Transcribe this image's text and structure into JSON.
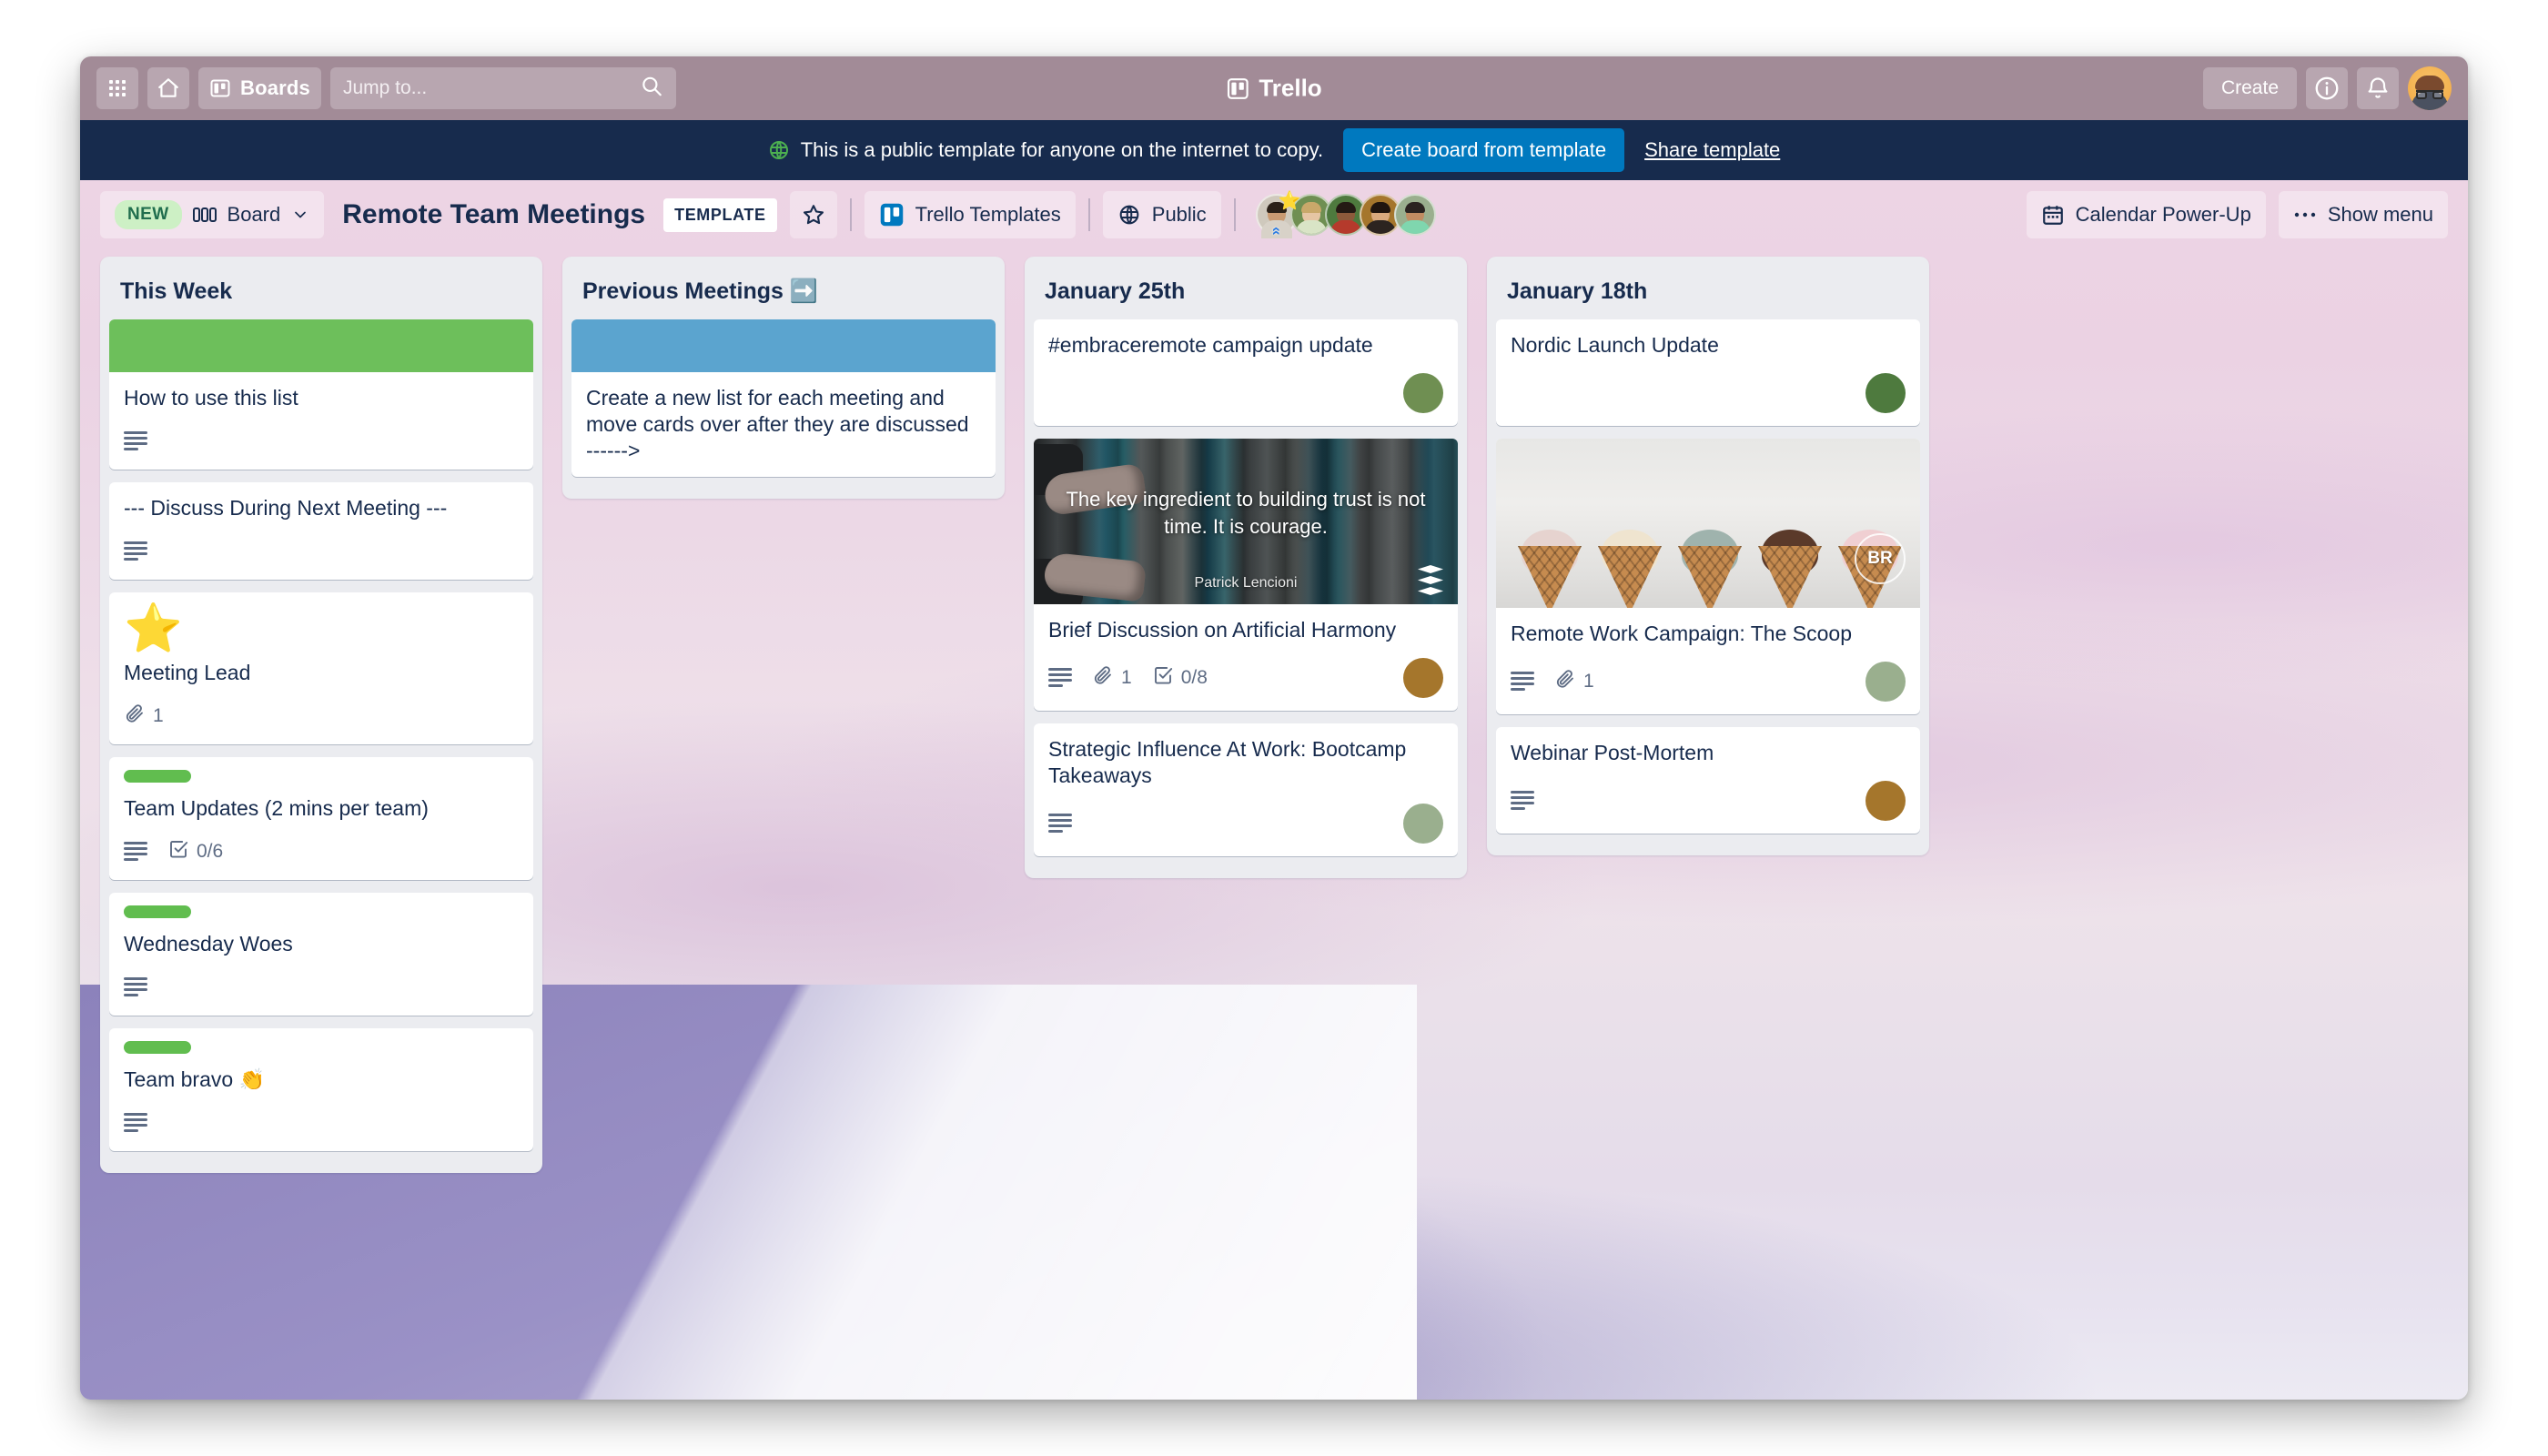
{
  "topnav": {
    "apps_icon": "apps-grid-icon",
    "home_icon": "home-icon",
    "boards_label": "Boards",
    "boards_icon": "board-icon",
    "search_placeholder": "Jump to...",
    "search_icon": "search-icon",
    "brand": "Trello",
    "brand_icon": "trello-logo-icon",
    "create_label": "Create",
    "info_icon": "info-circle-icon",
    "notifications_icon": "bell-icon",
    "avatar": "user-avatar"
  },
  "banner": {
    "globe_icon": "globe-icon",
    "text": "This is a public template for anyone on the internet to copy.",
    "cta_label": "Create board from template",
    "link_label": "Share template",
    "bg_color": "#172b4d",
    "cta_color": "#0079bf"
  },
  "board_header": {
    "new_badge": "NEW",
    "view_label": "Board",
    "view_icon": "board-view-icon",
    "chevron_icon": "chevron-down-icon",
    "title": "Remote Team Meetings",
    "template_chip": "TEMPLATE",
    "star_icon": "star-outline-icon",
    "workspace_label": "Trello Templates",
    "workspace_icon": "trello-logo-icon",
    "visibility_label": "Public",
    "visibility_icon": "globe-icon",
    "members": [
      {
        "name": "member-1",
        "skin": "#c99a72",
        "hair": "#2b2118",
        "shirt": "#d8d2c8",
        "bg": "#cfc9bd",
        "badge": "star"
      },
      {
        "name": "member-2",
        "skin": "#e6c5a4",
        "hair": "#c9a86a",
        "shirt": "#d9e4c6",
        "bg": "#6f8f52"
      },
      {
        "name": "member-3",
        "skin": "#8d5a3b",
        "hair": "#241a14",
        "shirt": "#b53a2c",
        "bg": "#4e7a3e"
      },
      {
        "name": "member-4",
        "skin": "#d9a97e",
        "hair": "#20150f",
        "shirt": "#2c2420",
        "bg": "#a5762c"
      },
      {
        "name": "member-5",
        "skin": "#c08c62",
        "hair": "#2a2320",
        "shirt": "#7fd6ae",
        "bg": "#9aaf8e"
      }
    ],
    "calendar_label": "Calendar Power-Up",
    "calendar_icon": "calendar-icon",
    "menu_label": "Show menu",
    "menu_icon": "ellipsis-icon"
  },
  "lists": [
    {
      "title": "This Week",
      "cards": [
        {
          "kind": "cover-band",
          "cover_color": "#6dbf5b",
          "title": "How to use this list",
          "badges": {
            "description": true
          }
        },
        {
          "kind": "plain",
          "title": "--- Discuss During Next Meeting ---",
          "badges": {
            "description": true
          }
        },
        {
          "kind": "emoji",
          "emoji": "⭐",
          "title": "Meeting Lead",
          "badges": {
            "attachments": "1"
          }
        },
        {
          "kind": "label",
          "label_color": "#61bd4f",
          "title": "Team Updates (2 mins per team)",
          "badges": {
            "description": true,
            "checklist": "0/6"
          }
        },
        {
          "kind": "label",
          "label_color": "#61bd4f",
          "title": "Wednesday Woes",
          "badges": {
            "description": true
          }
        },
        {
          "kind": "label",
          "label_color": "#61bd4f",
          "title": "Team bravo 👏",
          "badges": {
            "description": true
          }
        }
      ]
    },
    {
      "title": "Previous Meetings ➡️",
      "cards": [
        {
          "kind": "cover-band",
          "cover_color": "#5ba4cf",
          "title": "Create a new list for each meeting and move cards over after they are discussed ------>",
          "badges": {}
        }
      ]
    },
    {
      "title": "January 25th",
      "cards": [
        {
          "kind": "plain",
          "title": "#embraceremote campaign update",
          "badges": {},
          "avatar": {
            "name": "member-2",
            "skin": "#e6c5a4",
            "hair": "#c9a86a",
            "shirt": "#d9e4c6",
            "bg": "#6f8f52"
          }
        },
        {
          "kind": "quote-cover",
          "quote": "The key ingredient to building trust is not time. It is courage.",
          "quote_author": "Patrick Lencioni",
          "stack_icon": "stacked-layers-icon",
          "title": "Brief Discussion on Artificial Harmony",
          "badges": {
            "description": true,
            "attachments": "1",
            "checklist": "0/8"
          },
          "avatar": {
            "name": "member-4",
            "skin": "#d9a97e",
            "hair": "#20150f",
            "shirt": "#2c2420",
            "bg": "#a5762c"
          }
        },
        {
          "kind": "plain",
          "title": "Strategic Influence At Work: Bootcamp Takeaways",
          "badges": {
            "description": true
          },
          "avatar": {
            "name": "member-5",
            "skin": "#c08c62",
            "hair": "#2a2320",
            "shirt": "#7fd6ae",
            "bg": "#9aaf8e"
          }
        }
      ]
    },
    {
      "title": "January 18th",
      "cards": [
        {
          "kind": "plain",
          "title": "Nordic Launch Update",
          "badges": {},
          "avatar": {
            "name": "member-3",
            "skin": "#8d5a3b",
            "hair": "#241a14",
            "shirt": "#b53a2c",
            "bg": "#4e7a3e"
          }
        },
        {
          "kind": "icecream-cover",
          "cover_caption": "ice-cream-cones-photo",
          "br_logo": "BR",
          "title": "Remote Work Campaign: The Scoop",
          "badges": {
            "description": true,
            "attachments": "1"
          },
          "avatar": {
            "name": "member-5",
            "skin": "#c08c62",
            "hair": "#2a2320",
            "shirt": "#7fd6ae",
            "bg": "#9aaf8e"
          }
        },
        {
          "kind": "plain",
          "title": "Webinar Post-Mortem",
          "badges": {
            "description": true
          },
          "avatar": {
            "name": "member-4",
            "skin": "#d9a97e",
            "hair": "#20150f",
            "shirt": "#2c2420",
            "bg": "#a5762c"
          }
        }
      ]
    }
  ]
}
